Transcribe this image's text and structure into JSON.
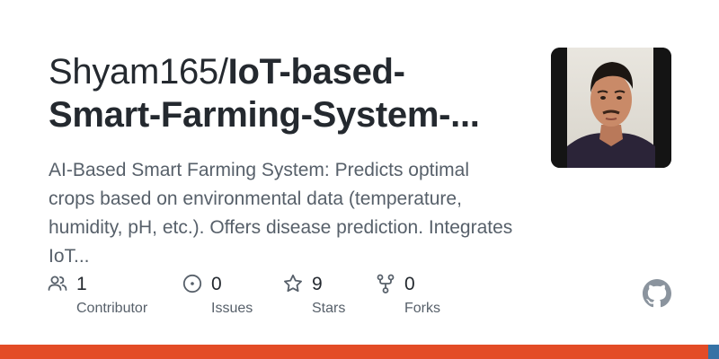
{
  "repo": {
    "owner": "Shyam165/",
    "name_line1": "IoT-based-",
    "name_line2": "Smart-Farming-System-...",
    "description": "AI-Based Smart Farming System: Predicts optimal crops based on environmental data (temperature, humidity, pH, etc.). Offers disease prediction. Integrates IoT..."
  },
  "stats": {
    "contributors": {
      "count": "1",
      "label": "Contributor",
      "icon": "people-icon"
    },
    "issues": {
      "count": "0",
      "label": "Issues",
      "icon": "issue-opened-icon"
    },
    "stars": {
      "count": "9",
      "label": "Stars",
      "icon": "star-icon"
    },
    "forks": {
      "count": "0",
      "label": "Forks",
      "icon": "repo-forked-icon"
    }
  },
  "language_bar": [
    {
      "color": "#e34c26",
      "fraction": 0.985
    },
    {
      "color": "#3572a5",
      "fraction": 0.015
    }
  ],
  "colors": {
    "title": "#24292f",
    "muted": "#57606a",
    "icon": "#57606a",
    "github_logo": "#8b949e"
  }
}
